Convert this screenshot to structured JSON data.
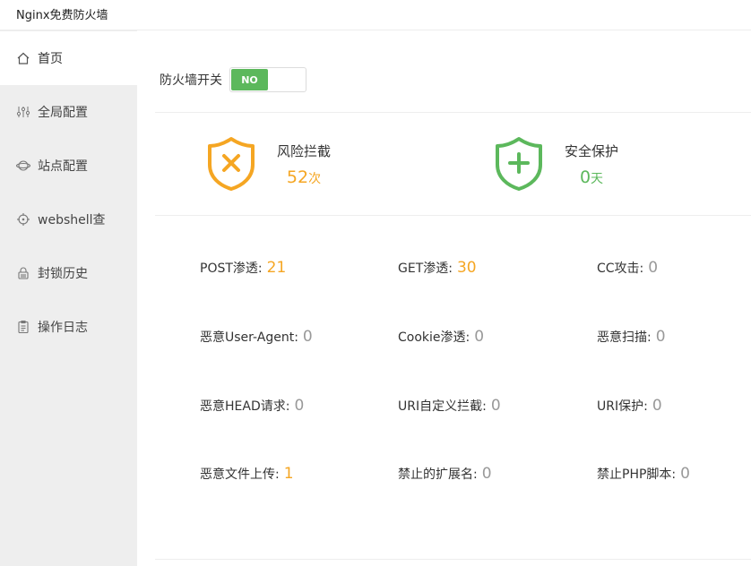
{
  "app": {
    "title": "Nginx免费防火墙"
  },
  "colors": {
    "accent_green": "#5cb85c",
    "warning_orange": "#f5a623",
    "muted_gray": "#999999",
    "sidebar_bg": "#eeeeee"
  },
  "sidebar": {
    "items": [
      {
        "label": "首页",
        "icon": "home-icon",
        "active": true
      },
      {
        "label": "全局配置",
        "icon": "sliders-icon",
        "active": false
      },
      {
        "label": "站点配置",
        "icon": "globe-icon",
        "active": false
      },
      {
        "label": "webshell查",
        "icon": "target-icon",
        "active": false
      },
      {
        "label": "封锁历史",
        "icon": "lock-icon",
        "active": false
      },
      {
        "label": "操作日志",
        "icon": "clipboard-icon",
        "active": false
      }
    ]
  },
  "firewall": {
    "label": "防火墙开关",
    "toggle_text": "NO"
  },
  "stats": {
    "risk": {
      "title": "风险拦截",
      "value": "52",
      "unit": "次",
      "icon": "shield-x-icon"
    },
    "safe": {
      "title": "安全保护",
      "value": "0",
      "unit": "天",
      "icon": "shield-plus-icon"
    }
  },
  "metrics": [
    {
      "label": "POST渗透:",
      "value": "21"
    },
    {
      "label": "GET渗透:",
      "value": "30"
    },
    {
      "label": "CC攻击:",
      "value": "0"
    },
    {
      "label": "恶意User-Agent:",
      "value": "0"
    },
    {
      "label": "Cookie渗透:",
      "value": "0"
    },
    {
      "label": "恶意扫描:",
      "value": "0"
    },
    {
      "label": "恶意HEAD请求:",
      "value": "0"
    },
    {
      "label": "URI自定义拦截:",
      "value": "0"
    },
    {
      "label": "URI保护:",
      "value": "0"
    },
    {
      "label": "恶意文件上传:",
      "value": "1"
    },
    {
      "label": "禁止的扩展名:",
      "value": "0"
    },
    {
      "label": "禁止PHP脚本:",
      "value": "0"
    }
  ]
}
